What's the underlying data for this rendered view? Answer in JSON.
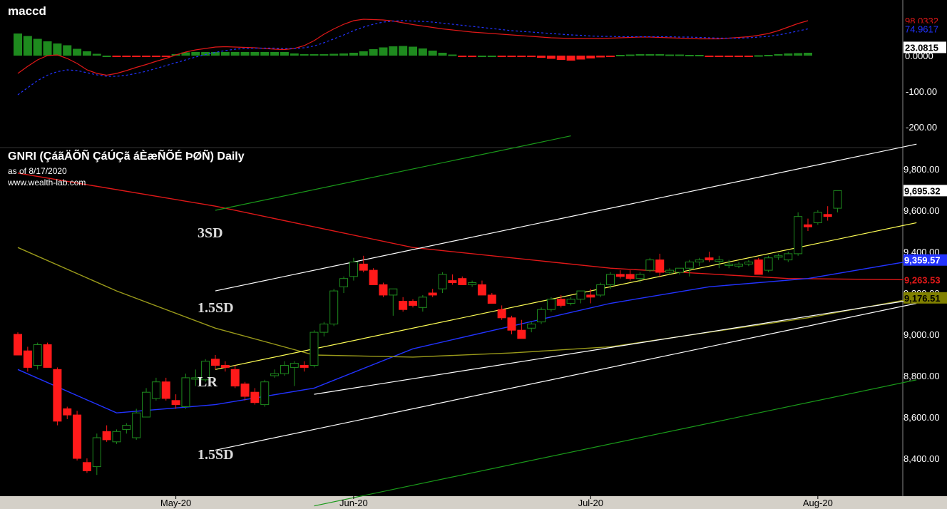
{
  "indicator_panel": {
    "title": "maccd"
  },
  "price_panel": {
    "title": "GNRI (ÇáãÄÕÑ ÇáÚÇã áÈæÑÕÉ ÞØÑ) Daily",
    "as_of": "as of 8/17/2020",
    "source": "www.wealth-lab.com"
  },
  "annotations": [
    "3SD",
    "1.5SD",
    "LR",
    "1.5SD"
  ],
  "colors": {
    "background": "#000000",
    "up": "#1e8a1e",
    "down": "#ff1a1a",
    "sma_red": "#e01818",
    "sma_blue": "#2233ff",
    "sma_olive": "#9a9a1a",
    "lr_line": "#ffff55",
    "sd_1_5": "#ffffff",
    "sd_3": "#1a9a1a"
  },
  "chart_data": [
    {
      "type": "bar",
      "title": "maccd",
      "ylim": [
        -260,
        130
      ],
      "yticks": [
        "-100.00",
        "-200.00"
      ],
      "last_value_labels": [
        "98.0332",
        "74.9617",
        "23.0815",
        "0.0000"
      ],
      "series": [
        {
          "name": "histogram",
          "values": [
            62,
            55,
            47,
            40,
            34,
            29,
            19,
            12,
            5,
            0,
            -3,
            -3,
            -3,
            -3,
            -3,
            -3,
            4,
            9,
            10,
            10,
            10,
            10,
            10,
            10,
            10,
            10,
            10,
            10,
            6,
            4,
            4,
            4,
            5,
            6,
            8,
            12,
            18,
            23,
            26,
            27,
            25,
            20,
            14,
            8,
            3,
            -1,
            -1,
            0,
            0,
            -1,
            -2,
            -3,
            -4,
            -6,
            -9,
            -12,
            -14,
            -11,
            -8,
            -5,
            -3,
            2,
            3,
            4,
            4,
            4,
            3,
            3,
            2,
            2,
            -2,
            -3,
            -3,
            -2,
            -2,
            1,
            2,
            4,
            6,
            7,
            8
          ]
        },
        {
          "name": "macd",
          "values": [
            -50,
            -30,
            -12,
            0,
            2,
            -8,
            -22,
            -40,
            -50,
            -55,
            -50,
            -42,
            -33,
            -25,
            -16,
            -8,
            2,
            10,
            16,
            20,
            24,
            25,
            24,
            23,
            22,
            20,
            18,
            17,
            20,
            28,
            42,
            60,
            75,
            88,
            98,
            102,
            101,
            100,
            97,
            92,
            87,
            83,
            79,
            75,
            72,
            69,
            66,
            64,
            62,
            60,
            58,
            56,
            54,
            52,
            50,
            49,
            48,
            48,
            48,
            48,
            49,
            50,
            51,
            52,
            52,
            51,
            50,
            49,
            48,
            47,
            47,
            47,
            49,
            51,
            53,
            57,
            62,
            70,
            80,
            90,
            98
          ]
        },
        {
          "name": "signal",
          "values": [
            -110,
            -90,
            -70,
            -55,
            -45,
            -40,
            -42,
            -48,
            -54,
            -58,
            -58,
            -55,
            -50,
            -44,
            -36,
            -28,
            -20,
            -12,
            -4,
            3,
            9,
            14,
            18,
            20,
            21,
            21,
            21,
            20,
            20,
            22,
            27,
            36,
            47,
            58,
            70,
            80,
            88,
            94,
            97,
            98,
            97,
            96,
            94,
            91,
            88,
            85,
            82,
            79,
            76,
            73,
            70,
            68,
            66,
            64,
            62,
            60,
            58,
            57,
            55,
            54,
            54,
            53,
            53,
            53,
            53,
            53,
            53,
            52,
            52,
            51,
            50,
            49,
            49,
            49,
            50,
            52,
            54,
            58,
            63,
            69,
            75
          ]
        }
      ]
    },
    {
      "type": "candlestick",
      "title": "GNRI (ÇáãÄÕÑ ÇáÚÇã áÈæÑÕÉ ÞØÑ) Daily",
      "x_labels": [
        "May-20",
        "Jun-20",
        "Jul-20",
        "Aug-20"
      ],
      "x_label_index": [
        16,
        34,
        58,
        81
      ],
      "ylim": [
        8230,
        9930
      ],
      "yticks": [
        8400,
        8600,
        8800,
        9000,
        9200,
        9400,
        9600,
        9800
      ],
      "price_labels": [
        "9,695.32",
        "9,359.57",
        "9,263.53",
        "9,176.51"
      ],
      "ohlc": [
        [
          9000,
          9010,
          8900,
          8900
        ],
        [
          8920,
          8940,
          8820,
          8840
        ],
        [
          8850,
          8960,
          8830,
          8950
        ],
        [
          8950,
          8960,
          8840,
          8840
        ],
        [
          8830,
          8840,
          8560,
          8580
        ],
        [
          8640,
          8650,
          8590,
          8610
        ],
        [
          8610,
          8630,
          8390,
          8400
        ],
        [
          8380,
          8400,
          8330,
          8340
        ],
        [
          8360,
          8520,
          8320,
          8500
        ],
        [
          8530,
          8560,
          8480,
          8490
        ],
        [
          8480,
          8540,
          8470,
          8530
        ],
        [
          8540,
          8570,
          8520,
          8560
        ],
        [
          8500,
          8640,
          8490,
          8620
        ],
        [
          8600,
          8740,
          8600,
          8720
        ],
        [
          8690,
          8790,
          8680,
          8770
        ],
        [
          8770,
          8790,
          8680,
          8690
        ],
        [
          8680,
          8710,
          8640,
          8660
        ],
        [
          8650,
          8810,
          8640,
          8790
        ],
        [
          8790,
          8830,
          8750,
          8790
        ],
        [
          8780,
          8880,
          8770,
          8870
        ],
        [
          8880,
          8900,
          8830,
          8850
        ],
        [
          8850,
          8870,
          8820,
          8840
        ],
        [
          8830,
          8850,
          8740,
          8750
        ],
        [
          8760,
          8770,
          8680,
          8700
        ],
        [
          8720,
          8740,
          8660,
          8670
        ],
        [
          8660,
          8780,
          8650,
          8770
        ],
        [
          8800,
          8830,
          8790,
          8810
        ],
        [
          8810,
          8870,
          8800,
          8850
        ],
        [
          8840,
          8870,
          8750,
          8860
        ],
        [
          8850,
          8870,
          8820,
          8840
        ],
        [
          8850,
          9020,
          8840,
          9010
        ],
        [
          9010,
          9060,
          8990,
          9050
        ],
        [
          9050,
          9220,
          9040,
          9210
        ],
        [
          9230,
          9280,
          9200,
          9270
        ],
        [
          9280,
          9370,
          9260,
          9350
        ],
        [
          9340,
          9380,
          9300,
          9310
        ],
        [
          9310,
          9320,
          9240,
          9240
        ],
        [
          9240,
          9250,
          9180,
          9190
        ],
        [
          9190,
          9220,
          9090,
          9220
        ],
        [
          9160,
          9180,
          9110,
          9120
        ],
        [
          9160,
          9170,
          9130,
          9140
        ],
        [
          9130,
          9190,
          9110,
          9180
        ],
        [
          9200,
          9220,
          9180,
          9190
        ],
        [
          9220,
          9300,
          9200,
          9290
        ],
        [
          9260,
          9290,
          9240,
          9250
        ],
        [
          9270,
          9280,
          9240,
          9240
        ],
        [
          9240,
          9260,
          9230,
          9250
        ],
        [
          9240,
          9260,
          9190,
          9190
        ],
        [
          9190,
          9200,
          9150,
          9150
        ],
        [
          9120,
          9140,
          9070,
          9080
        ],
        [
          9080,
          9090,
          9000,
          9020
        ],
        [
          9020,
          9070,
          8990,
          8980
        ],
        [
          9030,
          9060,
          9010,
          9050
        ],
        [
          9060,
          9130,
          9050,
          9120
        ],
        [
          9120,
          9180,
          9110,
          9170
        ],
        [
          9170,
          9190,
          9130,
          9140
        ],
        [
          9150,
          9180,
          9140,
          9170
        ],
        [
          9170,
          9210,
          9150,
          9210
        ],
        [
          9190,
          9220,
          9150,
          9180
        ],
        [
          9190,
          9250,
          9180,
          9240
        ],
        [
          9240,
          9300,
          9220,
          9290
        ],
        [
          9290,
          9310,
          9270,
          9280
        ],
        [
          9290,
          9310,
          9260,
          9270
        ],
        [
          9270,
          9300,
          9250,
          9290
        ],
        [
          9310,
          9370,
          9300,
          9360
        ],
        [
          9360,
          9390,
          9280,
          9300
        ],
        [
          9300,
          9320,
          9290,
          9310
        ],
        [
          9300,
          9320,
          9290,
          9320
        ],
        [
          9320,
          9360,
          9280,
          9350
        ],
        [
          9350,
          9370,
          9330,
          9360
        ],
        [
          9370,
          9400,
          9350,
          9360
        ],
        [
          9360,
          9380,
          9320,
          9360
        ],
        [
          9340,
          9360,
          9320,
          9340
        ],
        [
          9330,
          9350,
          9320,
          9340
        ],
        [
          9340,
          9360,
          9330,
          9350
        ],
        [
          9360,
          9370,
          9300,
          9290
        ],
        [
          9310,
          9380,
          9300,
          9370
        ],
        [
          9380,
          9390,
          9360,
          9380
        ],
        [
          9360,
          9400,
          9350,
          9390
        ],
        [
          9390,
          9590,
          9380,
          9570
        ],
        [
          9530,
          9560,
          9500,
          9520
        ],
        [
          9540,
          9600,
          9530,
          9590
        ],
        [
          9580,
          9620,
          9550,
          9570
        ],
        [
          9610,
          9680,
          9590,
          9695.32
        ]
      ],
      "overlays": [
        {
          "name": "sma_red",
          "color": "#e01818",
          "anchors": [
            [
              0,
              9780
            ],
            [
              20,
              9620
            ],
            [
              40,
              9420
            ],
            [
              60,
              9320
            ],
            [
              78,
              9270
            ],
            [
              91,
              9263.53
            ]
          ]
        },
        {
          "name": "sma_blue",
          "color": "#2233ff",
          "anchors": [
            [
              0,
              8830
            ],
            [
              10,
              8620
            ],
            [
              20,
              8660
            ],
            [
              30,
              8740
            ],
            [
              40,
              8930
            ],
            [
              50,
              9040
            ],
            [
              60,
              9150
            ],
            [
              70,
              9230
            ],
            [
              80,
              9270
            ],
            [
              91,
              9359.57
            ]
          ]
        },
        {
          "name": "sma_olive",
          "color": "#9a9a1a",
          "anchors": [
            [
              0,
              9420
            ],
            [
              10,
              9210
            ],
            [
              20,
              9030
            ],
            [
              30,
              8900
            ],
            [
              40,
              8890
            ],
            [
              50,
              8910
            ],
            [
              60,
              8940
            ],
            [
              70,
              9010
            ],
            [
              80,
              9080
            ],
            [
              91,
              9176.51
            ]
          ]
        },
        {
          "name": "lr",
          "color": "#ffff55",
          "anchors": [
            [
              20,
              8830
            ],
            [
              91,
              9540
            ]
          ]
        },
        {
          "name": "upper_1.5sd",
          "color": "#ffffff",
          "anchors": [
            [
              20,
              9210
            ],
            [
              91,
              9920
            ]
          ]
        },
        {
          "name": "lower_1.5sd",
          "color": "#ffffff",
          "anchors": [
            [
              20,
              8440
            ],
            [
              91,
              9150
            ]
          ]
        },
        {
          "name": "upper_3sd",
          "color": "#1a9a1a",
          "anchors": [
            [
              20,
              9600
            ],
            [
              56,
              9960
            ]
          ]
        },
        {
          "name": "lower_3sd",
          "color": "#1a9a1a",
          "anchors": [
            [
              30,
              8170
            ],
            [
              91,
              8780
            ]
          ]
        },
        {
          "name": "lower_1.5sd_b",
          "color": "#ffffff",
          "anchors": [
            [
              30,
              8710
            ],
            [
              91,
              9170
            ]
          ]
        }
      ]
    }
  ]
}
